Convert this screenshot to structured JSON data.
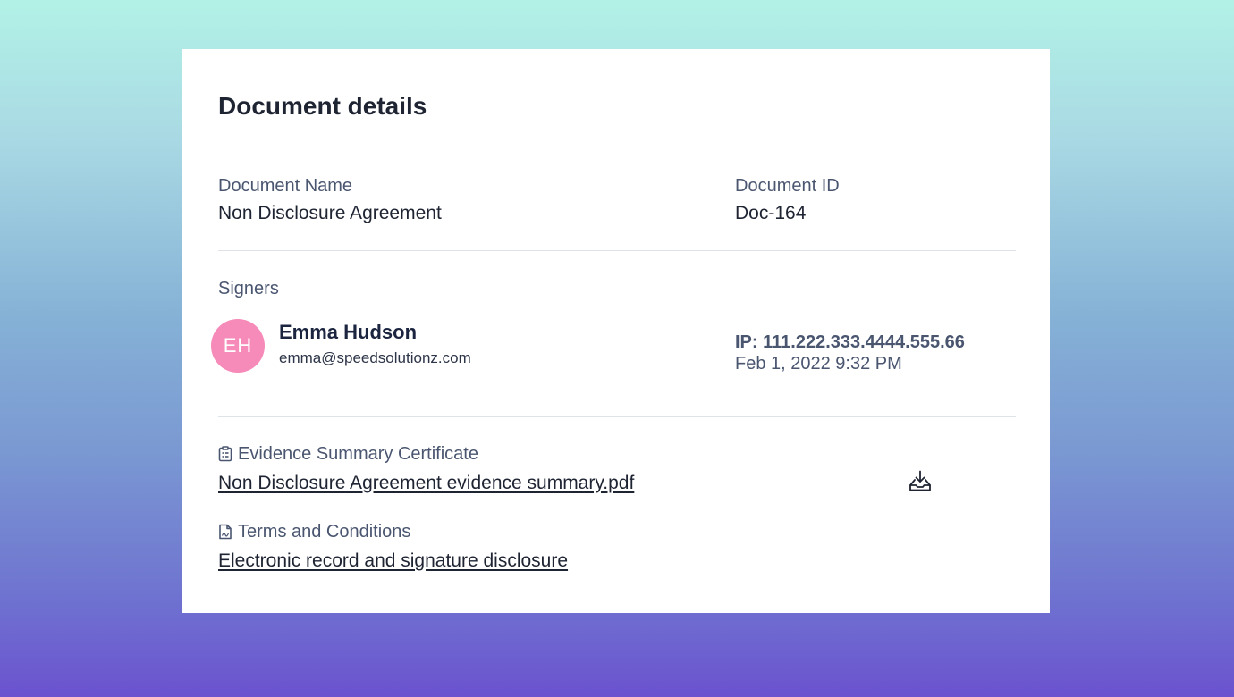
{
  "card": {
    "title": "Document details"
  },
  "document": {
    "name_label": "Document Name",
    "name_value": "Non Disclosure Agreement",
    "id_label": "Document ID",
    "id_value": "Doc-164"
  },
  "signers": {
    "label": "Signers",
    "items": [
      {
        "initials": "EH",
        "name": "Emma Hudson",
        "email": "emma@speedsolutionz.com",
        "ip": "IP: 111.222.333.4444.555.66",
        "timestamp": "Feb 1, 2022 9:32 PM",
        "avatar_color": "#f68ab8"
      }
    ]
  },
  "files": [
    {
      "heading": "Evidence Summary Certificate",
      "icon": "clipboard-list-icon",
      "link": "Non Disclosure Agreement evidence summary.pdf",
      "action_icon": "download-icon"
    },
    {
      "heading": "Terms and Conditions",
      "icon": "document-icon",
      "link": "Electronic record and signature disclosure"
    }
  ],
  "colors": {
    "text_primary": "#1f2433",
    "text_secondary": "#4a5670",
    "divider": "#dfe3e8"
  }
}
